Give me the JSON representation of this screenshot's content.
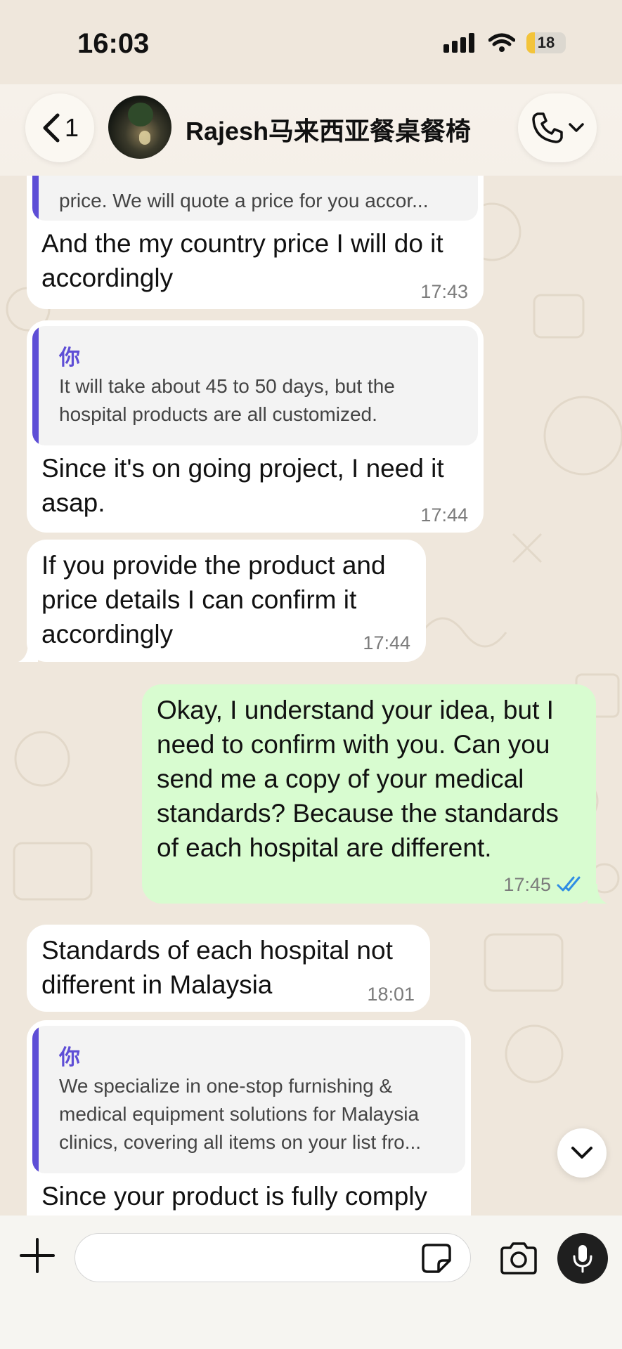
{
  "status_bar": {
    "time": "16:03",
    "battery": "18"
  },
  "header": {
    "back_count": "1",
    "contact_name": "Rajesh马来西亚餐桌餐椅"
  },
  "messages": [
    {
      "direction": "incoming",
      "quote_text": "price. We will quote a price for you accor...",
      "text": "And the my country price I will do it accordingly",
      "time": "17:43"
    },
    {
      "direction": "incoming",
      "quote_author": "你",
      "quote_text": "It will take about 45 to 50 days, but the hospital products are all customized.",
      "text": "Since it's on going project, I need it asap.",
      "time": "17:44"
    },
    {
      "direction": "incoming",
      "text": "If you provide the product and price details I can confirm it accordingly",
      "time": "17:44"
    },
    {
      "direction": "outgoing",
      "text": "Okay, I understand your idea, but I need to confirm with you. Can you send me a copy of your medical standards? Because the standards of each hospital are different.",
      "time": "17:45",
      "read": true
    },
    {
      "direction": "incoming",
      "text": "Standards of each hospital not different in Malaysia",
      "time": "18:01"
    },
    {
      "direction": "incoming",
      "quote_author": "你",
      "quote_text": "We specialize in one-stop furnishing & medical equipment solutions for Malaysia clinics, covering all items on your list fro...",
      "text": "Since your product is fully comply"
    }
  ],
  "colors": {
    "outgoing_bubble": "#d8fcd0",
    "incoming_bubble": "#ffffff",
    "quote_accent": "#5e4ed6",
    "read_ticks": "#2f8de4"
  },
  "icons": [
    "back-chevron-icon",
    "phone-icon",
    "chevron-down-icon",
    "plus-icon",
    "sticker-icon",
    "camera-icon",
    "microphone-icon",
    "double-check-icon"
  ]
}
